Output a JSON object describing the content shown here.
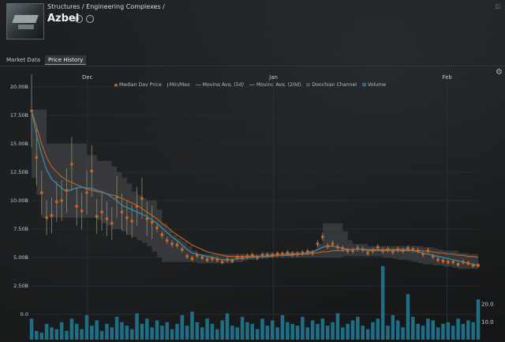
{
  "breadcrumb": "Structures / Engineering Complexes /",
  "item_name": "Azbel",
  "tabs": [
    {
      "label": "Market Data",
      "active": false
    },
    {
      "label": "Price History",
      "active": true
    }
  ],
  "icons": {
    "info": "info-icon",
    "show_in_menu": "circle-menu-icon",
    "settings": "gear-icon",
    "window_corner": "window-restore-icon"
  },
  "colors": {
    "median": "#c8641e",
    "minmax": "#9a9a7a",
    "ma5": "#3c8aa6",
    "ma20": "#b8622a",
    "donchian": "#4a4d52",
    "volume": "#1f6e86"
  },
  "legend": [
    {
      "label": "Median Day Price",
      "key": "median",
      "shape": "dot"
    },
    {
      "label": "Min/Max",
      "key": "minmax",
      "shape": "bar"
    },
    {
      "label": "Moving Avg. (5d)",
      "key": "ma5",
      "shape": "line"
    },
    {
      "label": "Moving Avg. (20d)",
      "key": "ma20",
      "shape": "line"
    },
    {
      "label": "Donchian Channel",
      "key": "donchian",
      "shape": "box"
    },
    {
      "label": "Volume",
      "key": "volume",
      "shape": "box"
    }
  ],
  "chart_data": {
    "type": "line",
    "x_ticks": [
      "Dec",
      "Jan",
      "Feb"
    ],
    "y_ticks": [
      "20.00B",
      "17.50B",
      "15.00B",
      "12.50B",
      "10.00B",
      "7.50B",
      "5.00B",
      "2.50B",
      "0.0"
    ],
    "y2_ticks": [
      "20.0",
      "10.0"
    ],
    "ylim": [
      0,
      20
    ],
    "y2lim": [
      0,
      46
    ],
    "n_days": 72,
    "x_tick_days": [
      9,
      39,
      67
    ],
    "series": [
      {
        "key": "median",
        "values": [
          17.9,
          13.8,
          10.7,
          8.5,
          8.7,
          9.9,
          10.0,
          10.9,
          13.2,
          9.5,
          9.1,
          10.7,
          12.6,
          8.6,
          9.0,
          8.4,
          8.0,
          10.3,
          9.0,
          8.5,
          8.2,
          9.5,
          10.2,
          8.4,
          8.1,
          7.6,
          7.0,
          6.5,
          6.2,
          6.1,
          5.7,
          5.1,
          4.9,
          5.2,
          5.0,
          4.8,
          4.9,
          4.8,
          4.6,
          4.8,
          4.7,
          5.0,
          5.0,
          5.1,
          5.2,
          5.0,
          5.2,
          5.2,
          5.2,
          5.3,
          5.3,
          5.4,
          5.3,
          5.3,
          5.4,
          5.5,
          5.4,
          6.2,
          6.8,
          6.0,
          6.2,
          5.9,
          5.8,
          5.6,
          5.6,
          5.8,
          5.7,
          5.4,
          5.6,
          5.9,
          5.6,
          5.7,
          5.5,
          5.7,
          5.6,
          5.8,
          5.7,
          5.6,
          5.3,
          5.6,
          5.1,
          4.8,
          4.7,
          4.6,
          4.6,
          4.4,
          4.6,
          4.5,
          4.3,
          4.3
        ]
      },
      {
        "key": "ma5",
        "values": [
          17.9,
          15.8,
          14.1,
          12.7,
          11.9,
          11.5,
          11.1,
          10.8,
          11.0,
          11.1,
          11.2,
          11.1,
          11.1,
          10.9,
          10.8,
          10.6,
          10.3,
          10.0,
          9.6,
          9.4,
          9.2,
          9.0,
          8.8,
          8.6,
          8.3,
          8.0,
          7.6,
          7.2,
          6.8,
          6.5,
          6.1,
          5.7,
          5.4,
          5.3,
          5.2,
          5.1,
          5.0,
          4.9,
          4.8,
          4.8,
          4.8,
          4.9,
          4.9,
          5.0,
          5.0,
          5.1,
          5.1,
          5.1,
          5.2,
          5.2,
          5.2,
          5.3,
          5.3,
          5.3,
          5.3,
          5.4,
          5.5,
          5.7,
          5.9,
          6.0,
          6.0,
          5.9,
          5.8,
          5.7,
          5.7,
          5.7,
          5.7,
          5.6,
          5.6,
          5.6,
          5.6,
          5.6,
          5.6,
          5.6,
          5.6,
          5.6,
          5.6,
          5.5,
          5.4,
          5.3,
          5.2,
          5.1,
          5.0,
          4.9,
          4.8,
          4.7,
          4.6,
          4.5,
          4.4,
          4.3
        ]
      },
      {
        "key": "ma20",
        "values": [
          17.9,
          16.5,
          15.0,
          13.8,
          13.0,
          12.5,
          12.1,
          11.8,
          11.6,
          11.4,
          11.2,
          11.0,
          10.9,
          10.8,
          10.7,
          10.6,
          10.5,
          10.4,
          10.2,
          10.0,
          9.8,
          9.6,
          9.3,
          9.0,
          8.7,
          8.4,
          8.0,
          7.7,
          7.3,
          7.0,
          6.7,
          6.4,
          6.1,
          5.9,
          5.7,
          5.5,
          5.4,
          5.3,
          5.2,
          5.1,
          5.1,
          5.1,
          5.1,
          5.1,
          5.1,
          5.1,
          5.1,
          5.1,
          5.1,
          5.2,
          5.2,
          5.2,
          5.2,
          5.3,
          5.3,
          5.3,
          5.4,
          5.4,
          5.5,
          5.5,
          5.6,
          5.6,
          5.6,
          5.7,
          5.7,
          5.7,
          5.7,
          5.7,
          5.7,
          5.7,
          5.7,
          5.7,
          5.7,
          5.7,
          5.7,
          5.7,
          5.6,
          5.6,
          5.6,
          5.5,
          5.5,
          5.4,
          5.4,
          5.3,
          5.3,
          5.2,
          5.2,
          5.1,
          5.1,
          5.0
        ]
      },
      {
        "key": "donchian_high",
        "values": [
          18.0,
          18.0,
          18.0,
          15.0,
          15.0,
          15.0,
          15.0,
          15.0,
          15.0,
          15.0,
          15.0,
          14.0,
          14.0,
          13.5,
          13.5,
          13.5,
          13.0,
          12.5,
          12.0,
          11.5,
          10.8,
          10.5,
          10.2,
          10.0,
          10.0,
          9.2,
          8.0,
          7.5,
          7.0,
          6.7,
          6.4,
          6.0,
          5.6,
          5.3,
          5.3,
          5.3,
          5.3,
          5.3,
          5.3,
          5.3,
          5.3,
          5.3,
          5.3,
          5.3,
          5.3,
          5.3,
          5.4,
          5.4,
          5.4,
          5.4,
          5.4,
          5.5,
          5.5,
          5.5,
          5.5,
          5.6,
          5.6,
          6.2,
          8.0,
          8.0,
          8.0,
          8.0,
          7.3,
          6.5,
          6.2,
          6.2,
          6.2,
          6.0,
          6.0,
          6.0,
          6.0,
          6.0,
          6.0,
          6.0,
          6.0,
          6.0,
          6.0,
          6.0,
          5.9,
          5.9,
          5.8,
          5.7,
          5.6,
          5.6,
          5.6,
          5.4,
          5.4,
          5.3,
          5.3,
          5.3
        ]
      },
      {
        "key": "donchian_low",
        "values": [
          12.0,
          10.5,
          8.5,
          8.5,
          8.5,
          8.5,
          8.5,
          8.5,
          8.5,
          8.5,
          8.5,
          8.5,
          8.5,
          8.3,
          8.0,
          7.8,
          7.5,
          7.5,
          7.3,
          7.0,
          6.8,
          6.5,
          6.3,
          6.0,
          5.5,
          5.0,
          4.6,
          4.6,
          4.6,
          4.6,
          4.6,
          4.6,
          4.6,
          4.5,
          4.5,
          4.5,
          4.5,
          4.5,
          4.5,
          4.5,
          4.6,
          4.6,
          4.7,
          4.8,
          4.8,
          4.9,
          4.9,
          5.0,
          5.0,
          5.0,
          5.0,
          5.0,
          5.0,
          5.0,
          5.0,
          5.0,
          5.0,
          5.0,
          5.0,
          5.0,
          5.0,
          5.0,
          5.1,
          5.1,
          5.1,
          5.1,
          5.1,
          5.1,
          5.1,
          5.1,
          5.0,
          5.0,
          4.9,
          4.8,
          4.8,
          4.7,
          4.6,
          4.5,
          4.4,
          4.4,
          4.3,
          4.3,
          4.2,
          4.2,
          4.1,
          4.0,
          4.0,
          4.0,
          4.0,
          4.0
        ]
      },
      {
        "key": "volume",
        "values": [
          12,
          5,
          4,
          9,
          7,
          6,
          10,
          5,
          12,
          9,
          6,
          14,
          8,
          11,
          5,
          9,
          7,
          13,
          10,
          8,
          6,
          15,
          9,
          12,
          7,
          11,
          8,
          10,
          6,
          9,
          14,
          8,
          16,
          10,
          7,
          12,
          9,
          6,
          11,
          15,
          8,
          7,
          13,
          10,
          9,
          6,
          12,
          8,
          11,
          7,
          14,
          10,
          9,
          8,
          13,
          7,
          11,
          9,
          12,
          8,
          10,
          15,
          7,
          9,
          11,
          13,
          8,
          6,
          10,
          12,
          9,
          8,
          14,
          11,
          7,
          10,
          13,
          9,
          8,
          12,
          11,
          7,
          9,
          10,
          8,
          6,
          9,
          11,
          10,
          8
        ]
      }
    ],
    "volume_spikes": [
      {
        "day": 57,
        "value": 42
      },
      {
        "day": 61,
        "value": 26
      },
      {
        "day": 69,
        "value": 12
      },
      {
        "day": 72,
        "value": 23
      }
    ]
  }
}
